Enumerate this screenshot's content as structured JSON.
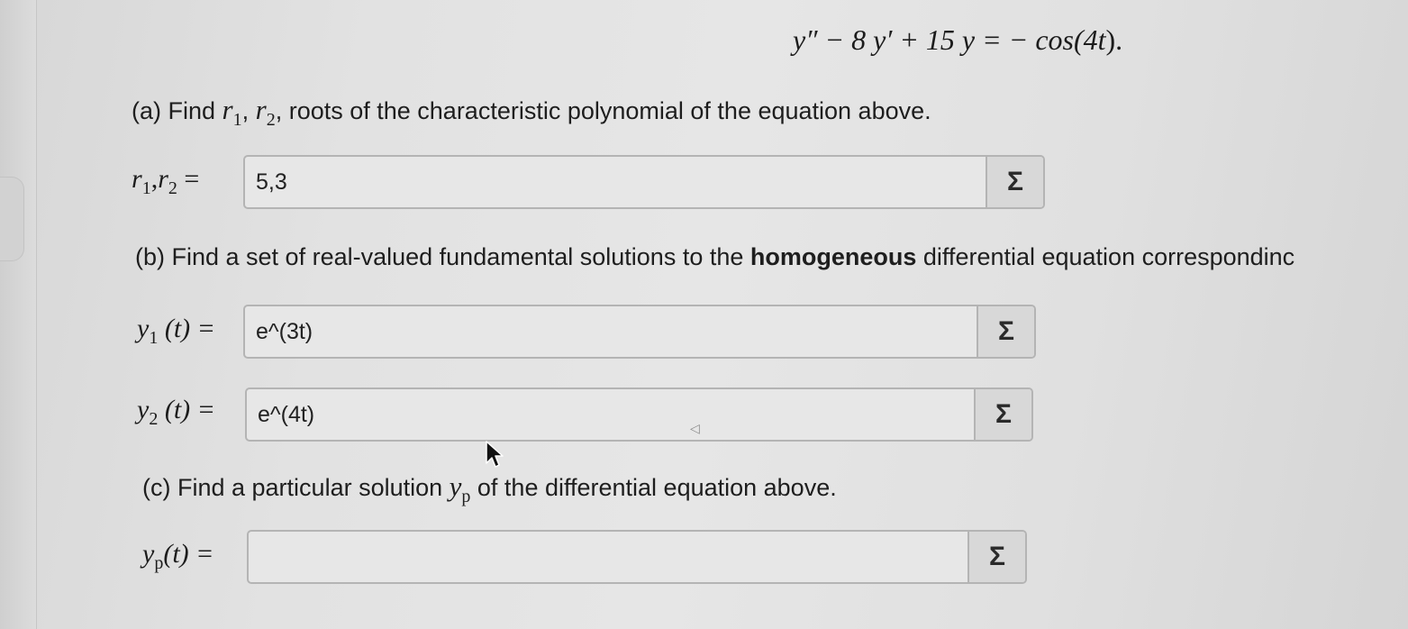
{
  "equation": {
    "lhs": "y″ − 8 y′ + 15 y = − cos(4",
    "t": "t",
    "tail": ")."
  },
  "part_a": {
    "prefix": "(a) Find ",
    "r": "r",
    "sub1": "1",
    "comma": ", ",
    "sub2": "2",
    "suffix": ", roots of the characteristic polynomial of the equation above.",
    "field_label_r": "r",
    "field_label_sub1": "1",
    "field_label_mid": ",",
    "field_label_sub2": "2",
    "field_label_eq": " =",
    "field_value": "5,3",
    "button_label": "Σ"
  },
  "part_b": {
    "prefix": "(b) Find a set of real-valued fundamental solutions to the ",
    "bold": "homogeneous",
    "suffix": " differential equation correspondinc",
    "y1_label_y": "y",
    "y1_label_sub": "1",
    "y1_label_rest": " (t) =",
    "y1_value": "e^(3t)",
    "y2_label_y": "y",
    "y2_label_sub": "2",
    "y2_label_rest": " (t) =",
    "y2_value": "e^(4t)",
    "button_label": "Σ"
  },
  "part_c": {
    "prefix": "(c) Find a particular solution ",
    "y": "y",
    "sub": "p",
    "suffix": " of the differential equation above.",
    "label_y": "y",
    "label_sub": "p",
    "label_rest": "(t) =",
    "field_value": "",
    "button_label": "Σ"
  },
  "icons": {
    "cursor": "mouse-pointer-icon",
    "sigma": "sigma-icon"
  },
  "colors": {
    "field_bg": "#e7e7e7",
    "field_border": "#b4b4b4",
    "button_bg": "#d8d8d8"
  }
}
